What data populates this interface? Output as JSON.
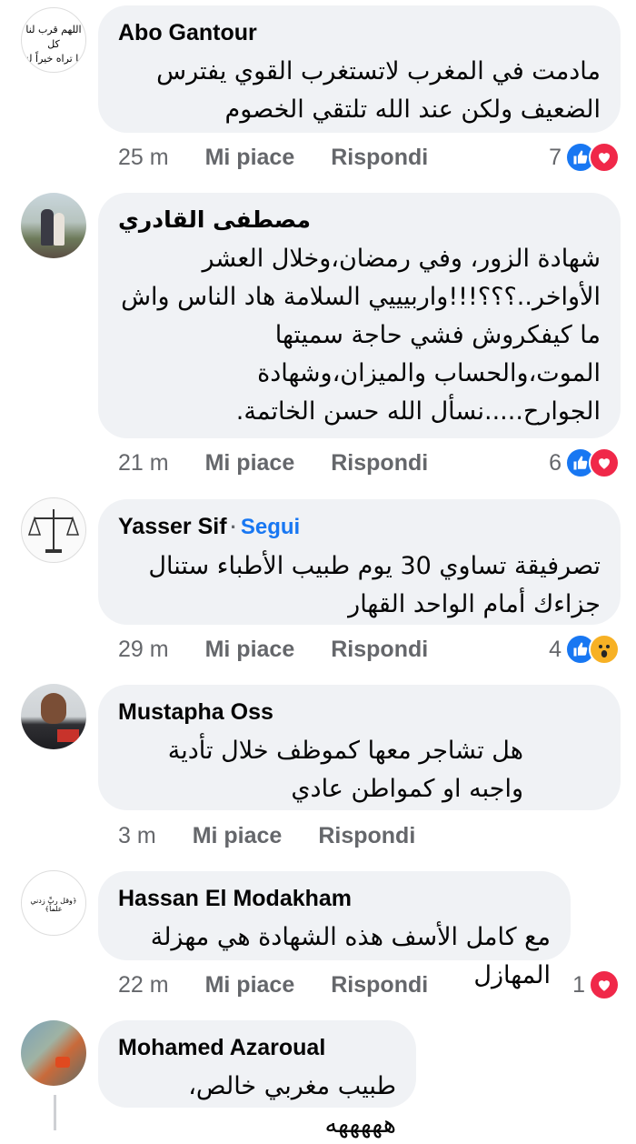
{
  "actions": {
    "like": "Mi piace",
    "reply": "Rispondi"
  },
  "comments": [
    {
      "author": "Abo Gantour",
      "text": "مادمت في المغرب لاتستغرب القوي يفترس الضعيف ولكن عند الله تلتقي الخصوم",
      "time": "25 m",
      "reaction_count": "7",
      "reactions": [
        "like-icon",
        "love-icon"
      ],
      "avatar_text_1": "اللهم قرب لنا كل",
      "avatar_text_2": "ما تراه خيراً لنا"
    },
    {
      "author": "مصطفى القادري",
      "text": "شهادة الزور، وفي رمضان،وخلال العشر الأواخر..؟؟؟!!!واربيييي السلامة هاد الناس واش ما كيفكروش فشي حاجة سميتها الموت،والحساب والميزان،وشهادة الجوارح.....نسأل الله حسن الخاتمة.",
      "time": "21 m",
      "reaction_count": "6",
      "reactions": [
        "like-icon",
        "love-icon"
      ]
    },
    {
      "author": "Yasser Sif",
      "follow": "Segui",
      "text": "تصرفيقة تساوي 30 يوم طبيب الأطباء ستنال جزاءك أمام الواحد القهار",
      "time": "29 m",
      "reaction_count": "4",
      "reactions": [
        "like-icon",
        "wow-icon"
      ]
    },
    {
      "author": "Mustapha Oss",
      "text": "هل تشاجر معها كموظف خلال تأدية واجبه او كمواطن عادي",
      "time": "3 m",
      "reaction_count": "",
      "reactions": []
    },
    {
      "author": "Hassan El Modakham",
      "text": "مع كامل الأسف هذه الشهادة هي مهزلة المهازل",
      "time": "22 m",
      "reaction_count": "1",
      "reactions": [
        "love-icon"
      ],
      "avatar_text_1": "﴿وقل ربِّ زدني علماً﴾"
    },
    {
      "author": "Mohamed Azaroual",
      "text": "طبيب مغربي خالص، هههههه",
      "time": "",
      "reaction_count": "",
      "reactions": []
    }
  ],
  "colors": {
    "like": "#1877f2",
    "love": "#f02849",
    "wow": "#f7b125",
    "bubble": "#f0f2f5",
    "meta": "#65676b"
  }
}
